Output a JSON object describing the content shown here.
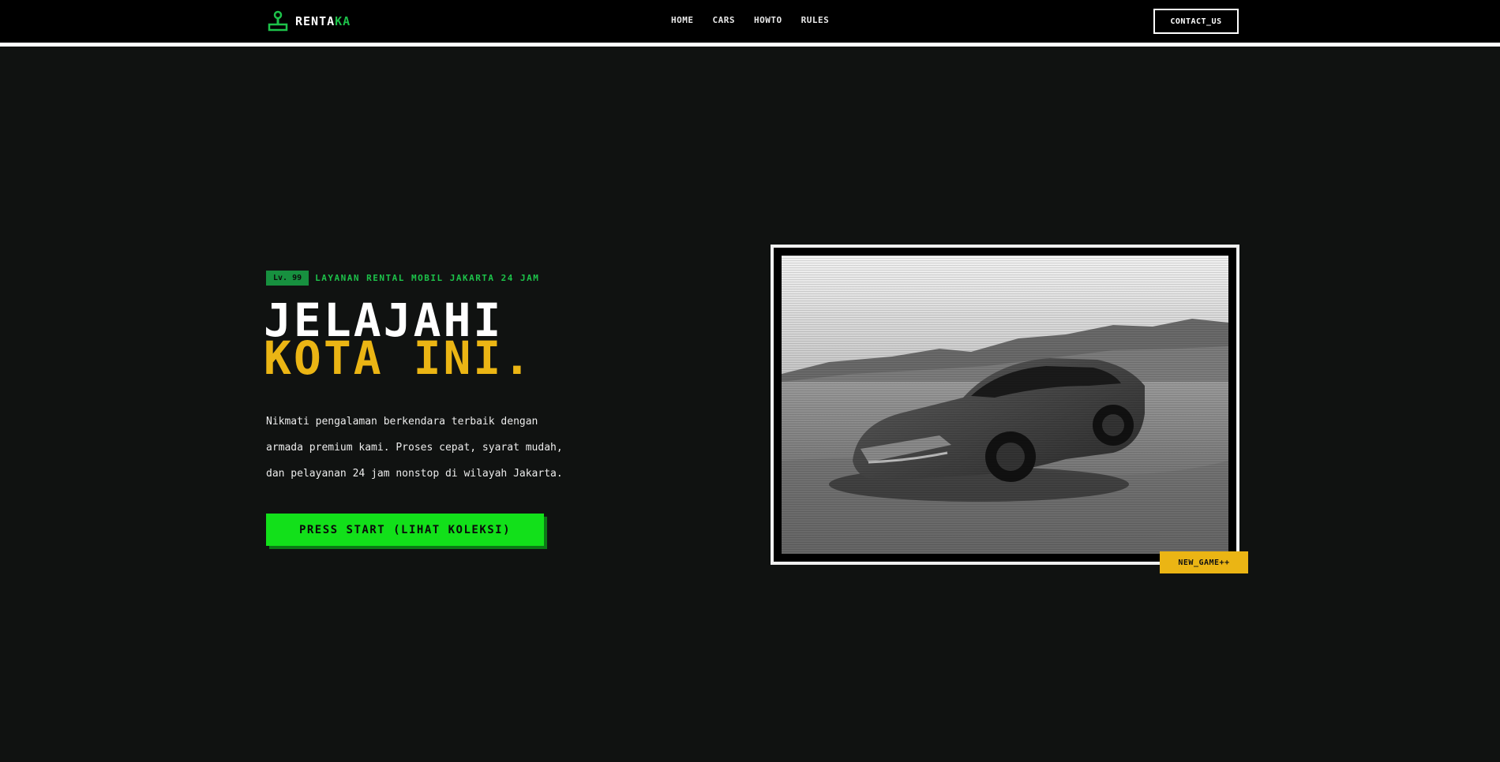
{
  "brand": {
    "name_part1": "RENTA",
    "name_part2": "KA",
    "accent_color": "#1dc24a",
    "icon": "joystick-icon"
  },
  "nav": {
    "items": [
      {
        "label": "HOME"
      },
      {
        "label": "CARS"
      },
      {
        "label": "HOWTO"
      },
      {
        "label": "RULES"
      }
    ],
    "contact_label": "CONTACT_US"
  },
  "hero": {
    "level_badge": "Lv. 99",
    "tagline": "LAYANAN RENTAL MOBIL JAKARTA 24 JAM",
    "title_line1": "JELAJAHI",
    "title_line2": "KOTA INI.",
    "title_accent_color": "#ebb514",
    "description_lines": [
      "Nikmati pengalaman berkendara terbaik dengan",
      "armada premium kami. Proses cepat, syarat mudah,",
      "dan pelayanan 24 jam nonstop di wilayah Jakarta."
    ],
    "cta_label": "PRESS START (LIHAT KOLEKSI)",
    "cta_color": "#12e01a"
  },
  "showcase": {
    "badge_label": "NEW_GAME++",
    "badge_color": "#ebb514"
  }
}
